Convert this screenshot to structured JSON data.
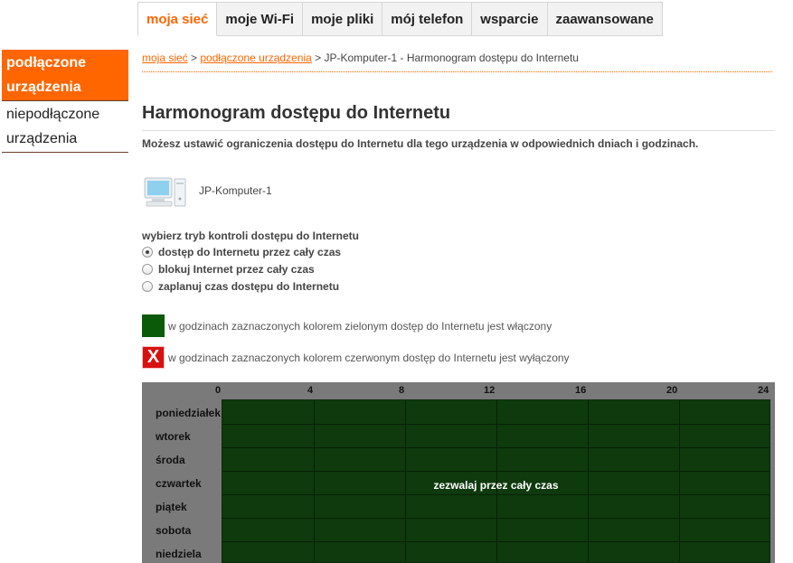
{
  "topnav": {
    "tabs": [
      {
        "label": "moja sieć",
        "active": true
      },
      {
        "label": "moje Wi-Fi",
        "active": false
      },
      {
        "label": "moje pliki",
        "active": false
      },
      {
        "label": "mój telefon",
        "active": false
      },
      {
        "label": "wsparcie",
        "active": false
      },
      {
        "label": "zaawansowane",
        "active": false
      }
    ]
  },
  "sidebar": {
    "items": [
      {
        "label": "podłączone urządzenia",
        "active": true
      },
      {
        "label": "niepodłączone urządzenia",
        "active": false
      }
    ]
  },
  "breadcrumb": {
    "link1": "moja sieć",
    "sep1": " > ",
    "link2": "podłączone urządzenia",
    "sep2": " > ",
    "current": "JP-Komputer-1 - Harmonogram dostępu do Internetu"
  },
  "page": {
    "title": "Harmonogram dostępu do Internetu",
    "description": "Możesz ustawić ograniczenia dostępu do Internetu dla tego urządzenia w odpowiednich dniach i godzinach."
  },
  "device": {
    "icon": "computer-icon",
    "name": "JP-Komputer-1"
  },
  "mode": {
    "label": "wybierz tryb kontroli dostępu do Internetu",
    "options": [
      {
        "label": "dostęp do Internetu przez cały czas",
        "checked": true
      },
      {
        "label": "blokuj Internet przez cały czas",
        "checked": false
      },
      {
        "label": "zaplanuj czas dostępu do Internetu",
        "checked": false
      }
    ]
  },
  "legend": {
    "green_text": "w godzinach zaznaczonych kolorem zielonym dostęp do Internetu jest włączony",
    "red_symbol": "X",
    "red_text": "w godzinach zaznaczonych kolorem czerwonym dostęp do Internetu jest wyłączony"
  },
  "schedule": {
    "hours": [
      "0",
      "4",
      "8",
      "12",
      "16",
      "20",
      "24"
    ],
    "days": [
      "poniedziałek",
      "wtorek",
      "środa",
      "czwartek",
      "piątek",
      "sobota",
      "niedziela"
    ],
    "overlay_text": "zezwalaj przez cały czas"
  },
  "colors": {
    "accent": "#ff6600",
    "allowed": "#0e3a0e",
    "blocked": "#d71010"
  }
}
